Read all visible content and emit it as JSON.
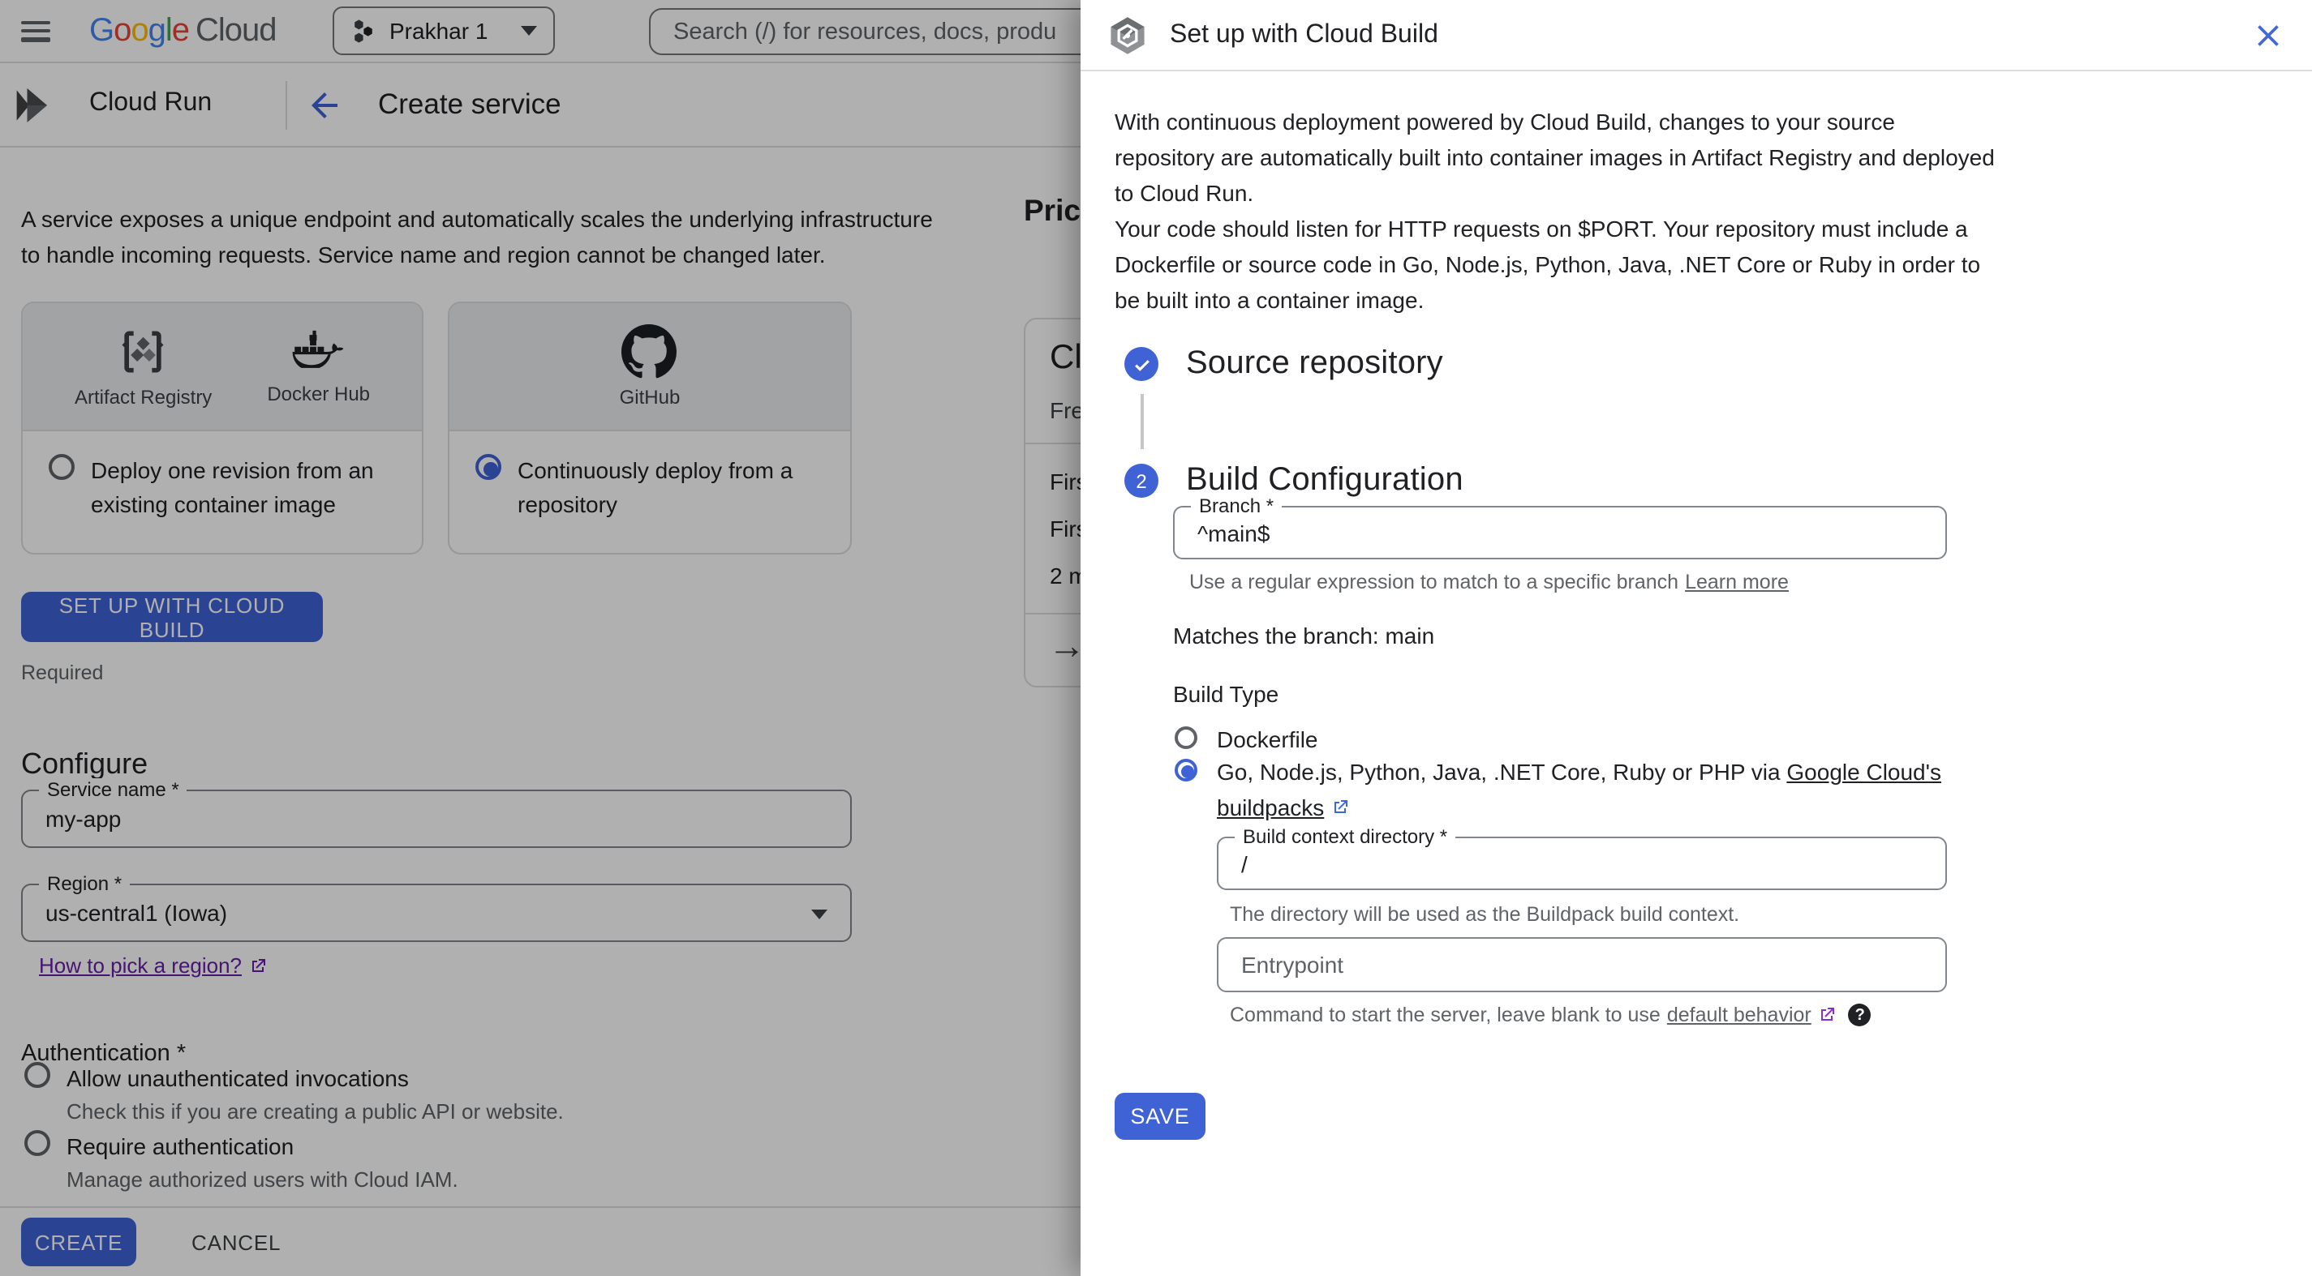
{
  "colors": {
    "primary_blue": "#3f62d5",
    "link_blue": "#3b66e0",
    "visited_purple": "#8430ce",
    "region_link_purple": "#681da8",
    "text_primary": "#202124",
    "text_secondary": "#5f6368",
    "border_gray": "#dadce0",
    "field_border": "#80868b",
    "scrim": "rgba(0,0,0,0.31)"
  },
  "topbar": {
    "logo_letters": [
      {
        "ch": "G",
        "style": "color:#4285f4"
      },
      {
        "ch": "o",
        "style": "color:#ea4335"
      },
      {
        "ch": "o",
        "style": "color:#fbbc05"
      },
      {
        "ch": "g",
        "style": "color:#4285f4"
      },
      {
        "ch": "l",
        "style": "color:#34a853"
      },
      {
        "ch": "e",
        "style": "color:#ea4335"
      }
    ],
    "logo_cloud": "Cloud",
    "project_name": "Prakhar 1",
    "search_placeholder": "Search (/) for resources, docs, produ"
  },
  "subheader": {
    "product": "Cloud Run",
    "page_title": "Create service"
  },
  "main": {
    "intro": "A service exposes a unique endpoint and automatically scales the underlying infrastructure to handle incoming requests. Service name and region cannot be changed later.",
    "card_registry": {
      "provider1": "Artifact Registry",
      "provider2": "Docker Hub",
      "option": "Deploy one revision from an existing container image",
      "selected": false
    },
    "card_github": {
      "provider1": "GitHub",
      "option": "Continuously deploy from a repository",
      "selected": true
    },
    "setup_button": "SET UP WITH CLOUD BUILD",
    "required_note": "Required",
    "configure": {
      "heading": "Configure",
      "service_name_label": "Service name *",
      "service_name_value": "my-app",
      "region_label": "Region *",
      "region_value": "us-central1 (Iowa)",
      "region_link": "How to pick a region?"
    },
    "authentication": {
      "heading": "Authentication *",
      "option1": "Allow unauthenticated invocations",
      "option1_sub": "Check this if you are creating a public API or website.",
      "option2": "Require authentication",
      "option2_sub": "Manage authorized users with Cloud IAM."
    },
    "pricing": {
      "heading_fragment": "Pric",
      "card_title_fragment": "Cl",
      "free_fragment": "Fre",
      "row1_fragment": "Firs",
      "row2_fragment": "Firs",
      "row3_fragment": "2 m",
      "arrow": "→"
    },
    "footer": {
      "create": "CREATE",
      "cancel": "CANCEL"
    }
  },
  "dialog": {
    "title": "Set up with Cloud Build",
    "intro_p1": "With continuous deployment powered by Cloud Build, changes to your source repository are automatically built into container images in Artifact Registry and deployed to Cloud Run.",
    "intro_p2": "Your code should listen for HTTP requests on $PORT. Your repository must include a Dockerfile or source code in Go, Node.js, Python, Java, .NET Core or Ruby in order to be built into a container image.",
    "step1_title": "Source repository",
    "step2_number": "2",
    "step2_title": "Build Configuration",
    "branch_label": "Branch *",
    "branch_value": "^main$",
    "branch_helper": "Use a regular expression to match to a specific branch ",
    "branch_helper_link": "Learn more",
    "matches_text": "Matches the branch: main",
    "build_type_label": "Build Type",
    "build_type_option1": "Dockerfile",
    "build_type_option2_prefix": "Go, Node.js, Python, Java, .NET Core, Ruby or PHP via ",
    "build_type_option2_link1": "Google Cloud's",
    "build_type_option2_link2": "buildpacks",
    "context_label": "Build context directory *",
    "context_value": "/",
    "context_helper": "The directory will be used as the Buildpack build context.",
    "entrypoint_placeholder": "Entrypoint",
    "entrypoint_helper": "Command to start the server, leave blank to use ",
    "entrypoint_helper_link": "default behavior",
    "save_button": "SAVE"
  }
}
